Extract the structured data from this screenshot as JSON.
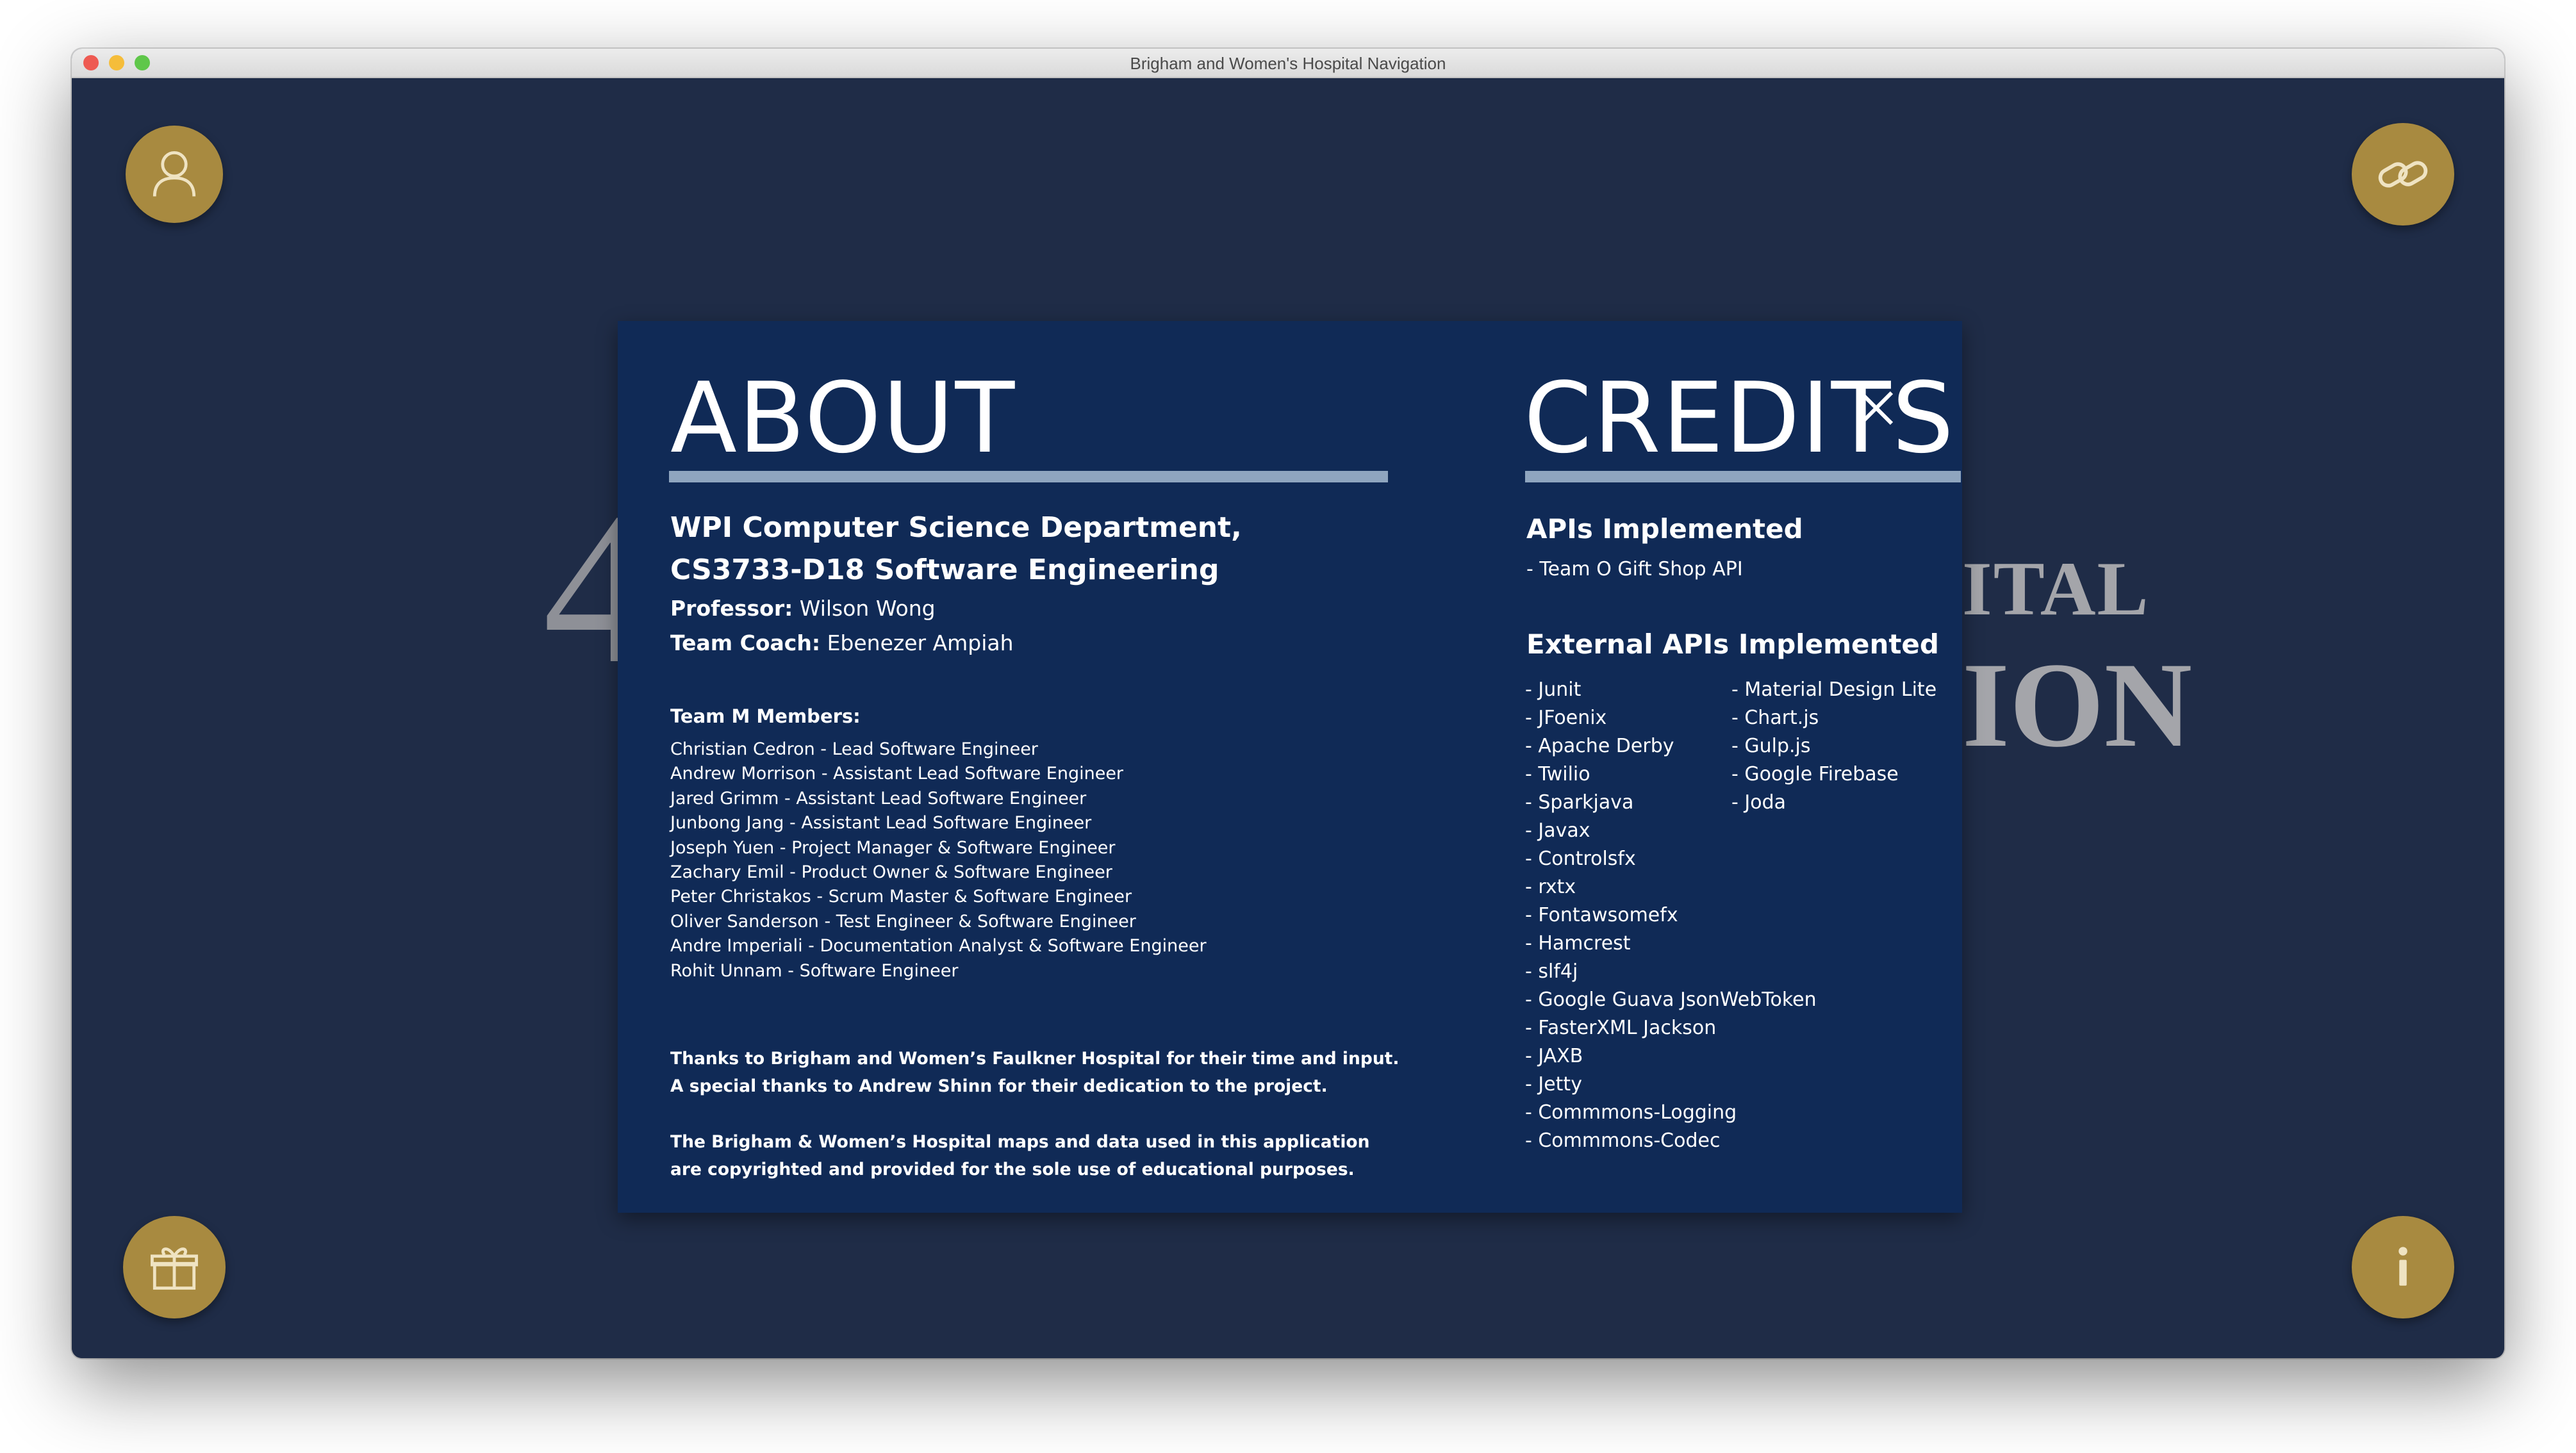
{
  "window": {
    "title": "Brigham and Women's Hospital Navigation"
  },
  "background": {
    "glyph": "4",
    "text_line_1": "ITAL",
    "text_line_2": "ION"
  },
  "corner_buttons": {
    "top_left_icon": "user-icon",
    "top_right_icon": "link-icon",
    "bottom_left_icon": "gift-icon",
    "bottom_right_icon": "info-icon",
    "color": "#a88a40"
  },
  "about": {
    "heading": "ABOUT",
    "department_line_1": "WPI Computer Science Department,",
    "department_line_2": "CS3733-D18 Software Engineering",
    "professor_label": "Professor:",
    "professor_name": "Wilson Wong",
    "coach_label": "Team Coach:",
    "coach_name": "Ebenezer Ampiah",
    "members_title": "Team M Members:",
    "members": [
      "Christian Cedron - Lead Software Engineer",
      "Andrew Morrison - Assistant Lead Software Engineer",
      "Jared Grimm - Assistant Lead Software Engineer",
      "Junbong Jang - Assistant Lead Software Engineer",
      "Joseph Yuen - Project Manager & Software Engineer",
      "Zachary Emil - Product Owner & Software Engineer",
      "Peter Christakos - Scrum Master & Software Engineer",
      "Oliver Sanderson - Test Engineer & Software Engineer",
      "Andre Imperiali - Documentation Analyst & Software Engineer",
      "Rohit Unnam - Software Engineer"
    ],
    "thanks": "Thanks to Brigham and Women’s Faulkner Hospital for their time and input. A special thanks to Andrew Shinn for their dedication to the project.",
    "copyright": "The Brigham & Women’s Hospital maps and data used in this application are copyrighted and provided for the sole use of educational purposes."
  },
  "credits": {
    "heading": "CREDITS",
    "close_icon": "close-icon",
    "apis_title": "APIs Implemented",
    "apis": [
      "- Team O Gift Shop API"
    ],
    "external_title": "External APIs Implemented",
    "external_col1": [
      "- Junit",
      "- JFoenix",
      "- Apache Derby",
      "- Twilio",
      "- Sparkjava",
      "- Javax",
      "- Controlsfx",
      "- rxtx",
      "- Fontawsomefx",
      "- Hamcrest",
      "- slf4j",
      "- Google Guava JsonWebToken",
      "- FasterXML Jackson",
      "- JAXB",
      "- Jetty",
      "- Commmons-Logging",
      "- Commmons-Codec"
    ],
    "external_col2": [
      "- Material Design Lite",
      "- Chart.js",
      "- Gulp.js",
      "- Google Firebase",
      "- Joda"
    ]
  }
}
